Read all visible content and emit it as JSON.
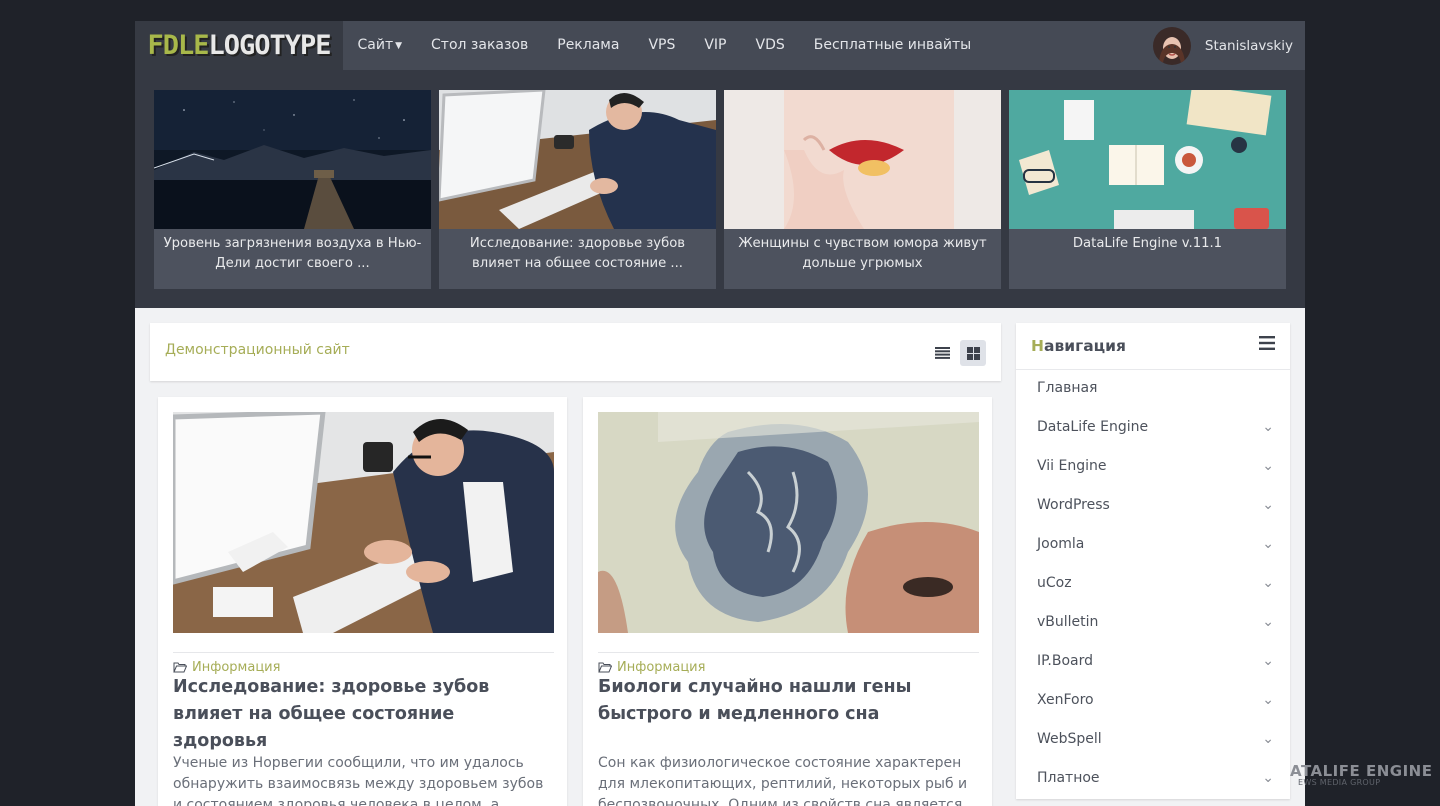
{
  "header": {
    "logo_part1": "FDLE",
    "logo_part2": "LOGOTYPE",
    "menu": [
      {
        "label": "Сайт",
        "has_dropdown": true
      },
      {
        "label": "Стол заказов"
      },
      {
        "label": "Реклама"
      },
      {
        "label": "VPS"
      },
      {
        "label": "VIP"
      },
      {
        "label": "VDS"
      },
      {
        "label": "Бесплатные инвайты"
      }
    ],
    "username": "Stanislavskiy"
  },
  "featured": [
    {
      "caption": "Уровень загрязнения воздуха в Нью-Дели достиг своего ...",
      "image": "night-lake-pier"
    },
    {
      "caption": "Исследование: здоровье зубов влияет на общее состояние ...",
      "image": "man-typing-laptop"
    },
    {
      "caption": "Женщины с чувством юмора живут дольше угрюмых",
      "image": "woman-lips-candy"
    },
    {
      "caption": "DataLife Engine v.11.1",
      "image": "flat-desk-illustration"
    }
  ],
  "breadcrumb": {
    "title": "Демонстрационный сайт"
  },
  "view_toggle": {
    "active": "grid"
  },
  "posts": [
    {
      "category": "Информация",
      "title": "Исследование: здоровье зубов влияет на общее состояние здоровья",
      "excerpt": "Ученые из Норвегии сообщили, что им удалось обнаружить взаимосвязь между здоровьем зубов и состоянием здоровья человека в целом, а также о",
      "image": "man-typing-laptop"
    },
    {
      "category": "Информация",
      "title": "Биологи случайно нашли гены быстрого и медленного сна",
      "excerpt": "Сон как физиологическое состояние характерен для млекопитающих, рептилий, некоторых рыб и беспозвоночных. Одним из свойств сна является",
      "image": "brain-slice"
    }
  ],
  "sidebar": {
    "title_first": "Н",
    "title_rest": "авигация",
    "items": [
      {
        "label": "Главная",
        "expandable": false
      },
      {
        "label": "DataLife Engine",
        "expandable": true
      },
      {
        "label": "Vii Engine",
        "expandable": true
      },
      {
        "label": "WordPress",
        "expandable": true
      },
      {
        "label": "Joomla",
        "expandable": true
      },
      {
        "label": "uCoz",
        "expandable": true
      },
      {
        "label": "vBulletin",
        "expandable": true
      },
      {
        "label": "IP.Board",
        "expandable": true
      },
      {
        "label": "XenForo",
        "expandable": true
      },
      {
        "label": "WebSpell",
        "expandable": true
      },
      {
        "label": "Платное",
        "expandable": true
      }
    ]
  },
  "watermark": {
    "line1": "ATALIFE ENGINE",
    "line2": "EWS MEDIA GROUP"
  },
  "colors": {
    "accent": "#a6ad57",
    "nav_bg": "#454a55",
    "page_bg": "#1f2229",
    "featured_bg": "#353943"
  }
}
